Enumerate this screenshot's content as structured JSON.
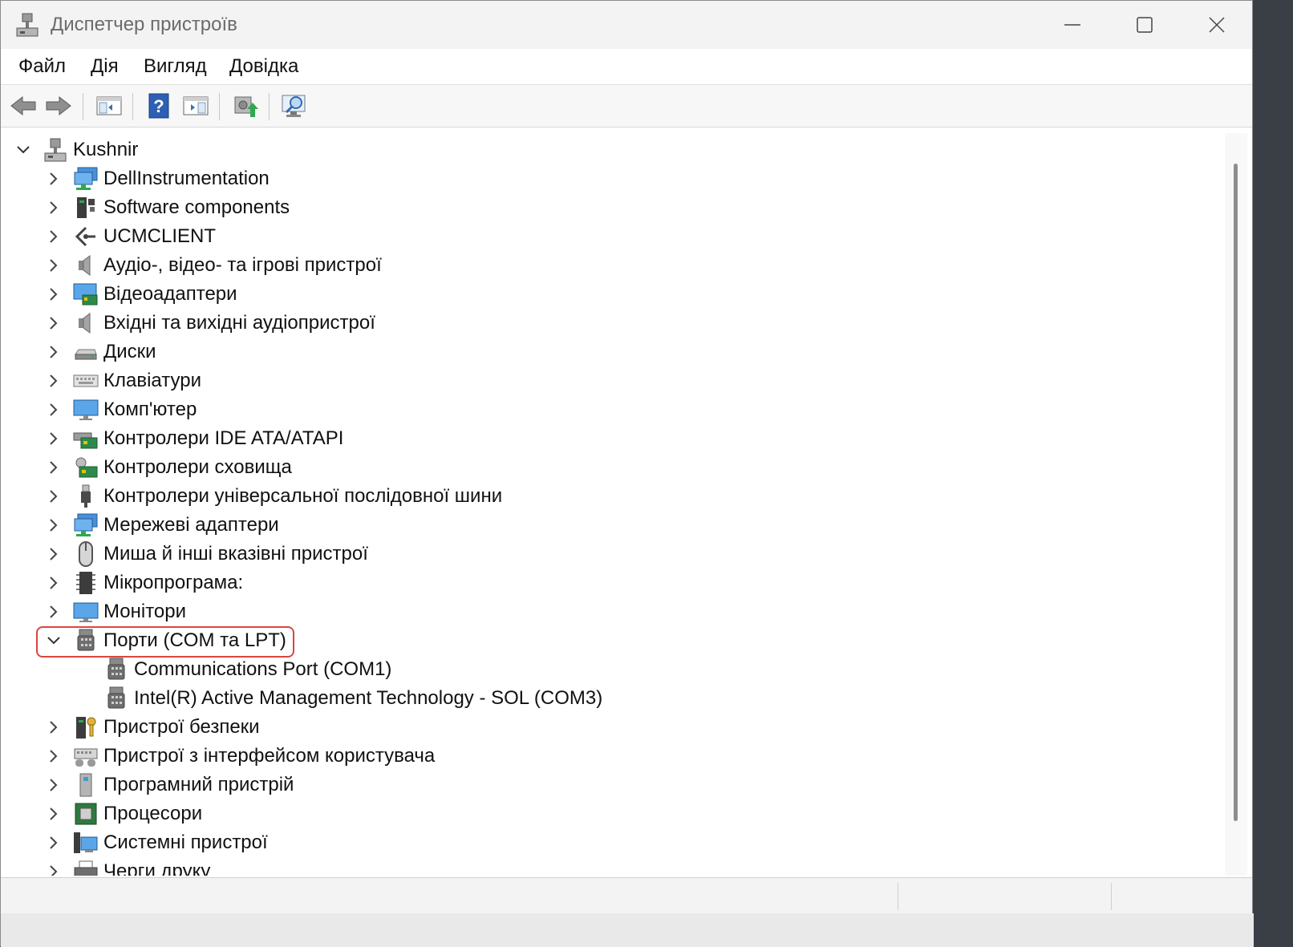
{
  "window": {
    "title": "Диспетчер пристроїв"
  },
  "menu": [
    "Файл",
    "Дія",
    "Вигляд",
    "Довідка"
  ],
  "toolbar": [
    {
      "name": "back-arrow-icon"
    },
    {
      "name": "forward-arrow-icon"
    },
    {
      "name": "show-hide-console-tree-icon"
    },
    {
      "name": "help-icon"
    },
    {
      "name": "show-action-pane-icon"
    },
    {
      "name": "update-driver-icon"
    },
    {
      "name": "scan-hardware-changes-icon"
    }
  ],
  "tree": {
    "root": {
      "label": "Kushnir",
      "expanded": true
    },
    "items": [
      {
        "label": "DellInstrumentation",
        "icon": "network-monitor-icon",
        "expanded": false
      },
      {
        "label": "Software components",
        "icon": "software-components-icon",
        "expanded": false
      },
      {
        "label": "UCMCLIENT",
        "icon": "ucm-client-icon",
        "expanded": false
      },
      {
        "label": "Аудіо-, відео- та ігрові пристрої",
        "icon": "speaker-icon",
        "expanded": false
      },
      {
        "label": "Відеоадаптери",
        "icon": "display-adapter-icon",
        "expanded": false
      },
      {
        "label": "Вхідні та вихідні аудіопристрої",
        "icon": "speaker-icon",
        "expanded": false
      },
      {
        "label": "Диски",
        "icon": "disk-drive-icon",
        "expanded": false
      },
      {
        "label": "Клавіатури",
        "icon": "keyboard-icon",
        "expanded": false
      },
      {
        "label": "Комп'ютер",
        "icon": "computer-icon",
        "expanded": false
      },
      {
        "label": "Контролери IDE ATA/ATAPI",
        "icon": "ide-controller-icon",
        "expanded": false
      },
      {
        "label": "Контролери сховища",
        "icon": "storage-controller-icon",
        "expanded": false
      },
      {
        "label": "Контролери універсальної послідовної шини",
        "icon": "usb-icon",
        "expanded": false
      },
      {
        "label": "Мережеві адаптери",
        "icon": "network-adapter-icon",
        "expanded": false
      },
      {
        "label": "Миша й інші вказівні пристрої",
        "icon": "mouse-icon",
        "expanded": false
      },
      {
        "label": "Мікропрограма:",
        "icon": "firmware-chip-icon",
        "expanded": false
      },
      {
        "label": "Монітори",
        "icon": "monitor-icon",
        "expanded": false
      },
      {
        "label": "Порти (COM та LPT)",
        "icon": "port-icon",
        "expanded": true,
        "highlighted": true,
        "children": [
          {
            "label": "Communications Port (COM1)",
            "icon": "port-icon"
          },
          {
            "label": "Intel(R) Active Management Technology - SOL (COM3)",
            "icon": "port-icon"
          }
        ]
      },
      {
        "label": "Пристрої безпеки",
        "icon": "security-device-icon",
        "expanded": false
      },
      {
        "label": "Пристрої з інтерфейсом користувача",
        "icon": "hid-icon",
        "expanded": false
      },
      {
        "label": "Програмний пристрій",
        "icon": "software-device-icon",
        "expanded": false
      },
      {
        "label": "Процесори",
        "icon": "processor-icon",
        "expanded": false
      },
      {
        "label": "Системні пристрої",
        "icon": "system-devices-icon",
        "expanded": false
      },
      {
        "label": "Черги друку",
        "icon": "print-queue-icon",
        "expanded": false
      }
    ]
  },
  "colors": {
    "highlight_border": "#d9463e",
    "accent": "#0067c0"
  }
}
